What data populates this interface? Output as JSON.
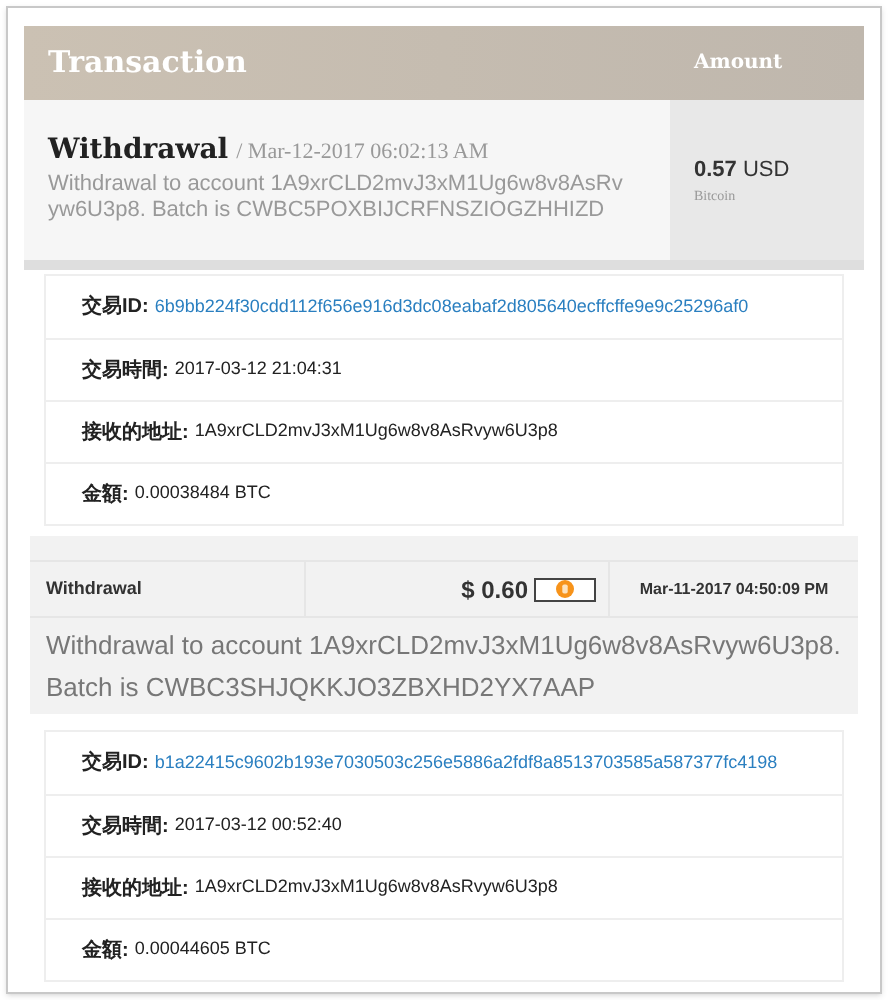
{
  "table": {
    "columns": [
      "Transaction",
      "Amount"
    ],
    "rows": [
      {
        "type": "Withdrawal",
        "date": "/ Mar-12-2017 06:02:13 AM",
        "description": "Withdrawal to account 1A9xrCLD2mvJ3xM1Ug6w8v8AsRvyw6U3p8. Batch is CWBC5POXBIJCRFNSZIOGZHHIZD",
        "amount": "0.57",
        "currency": "USD",
        "method": "Bitcoin"
      }
    ]
  },
  "details": [
    {
      "kind": "link",
      "label": "交易ID:",
      "value": "6b9bb224f30cdd112f656e916d3dc08eabaf2d805640ecffcffe9e9c25296af0"
    },
    {
      "kind": "text",
      "label": "交易時間:",
      "value": "2017-03-12 21:04:31"
    },
    {
      "kind": "text",
      "label": "接收的地址:",
      "value": "1A9xrCLD2mvJ3xM1Ug6w8v8AsRvyw6U3p8"
    },
    {
      "kind": "text",
      "label": "金額:",
      "value": "0.00038484 BTC"
    }
  ],
  "transaction": {
    "type": "Withdrawal",
    "amount": "$ 0.60",
    "date": "Mar-11-2017 04:50:09 PM",
    "description": "Withdrawal to account 1A9xrCLD2mvJ3xM1Ug6w8v8AsRvyw6U3p8. Batch is CWBC3SHJQKKJO3ZBXHD2YX7AAP",
    "details": [
      {
        "kind": "link",
        "label": "交易ID:",
        "value": "b1a22415c9602b193e7030503c256e5886a2fdf8a8513703585a587377fc4198"
      },
      {
        "kind": "text",
        "label": "交易時間:",
        "value": "2017-03-12 00:52:40"
      },
      {
        "kind": "text",
        "label": "接收的地址:",
        "value": "1A9xrCLD2mvJ3xM1Ug6w8v8AsRvyw6U3p8"
      },
      {
        "kind": "text",
        "label": "金額:",
        "value": "0.00044605 BTC"
      }
    ]
  }
}
